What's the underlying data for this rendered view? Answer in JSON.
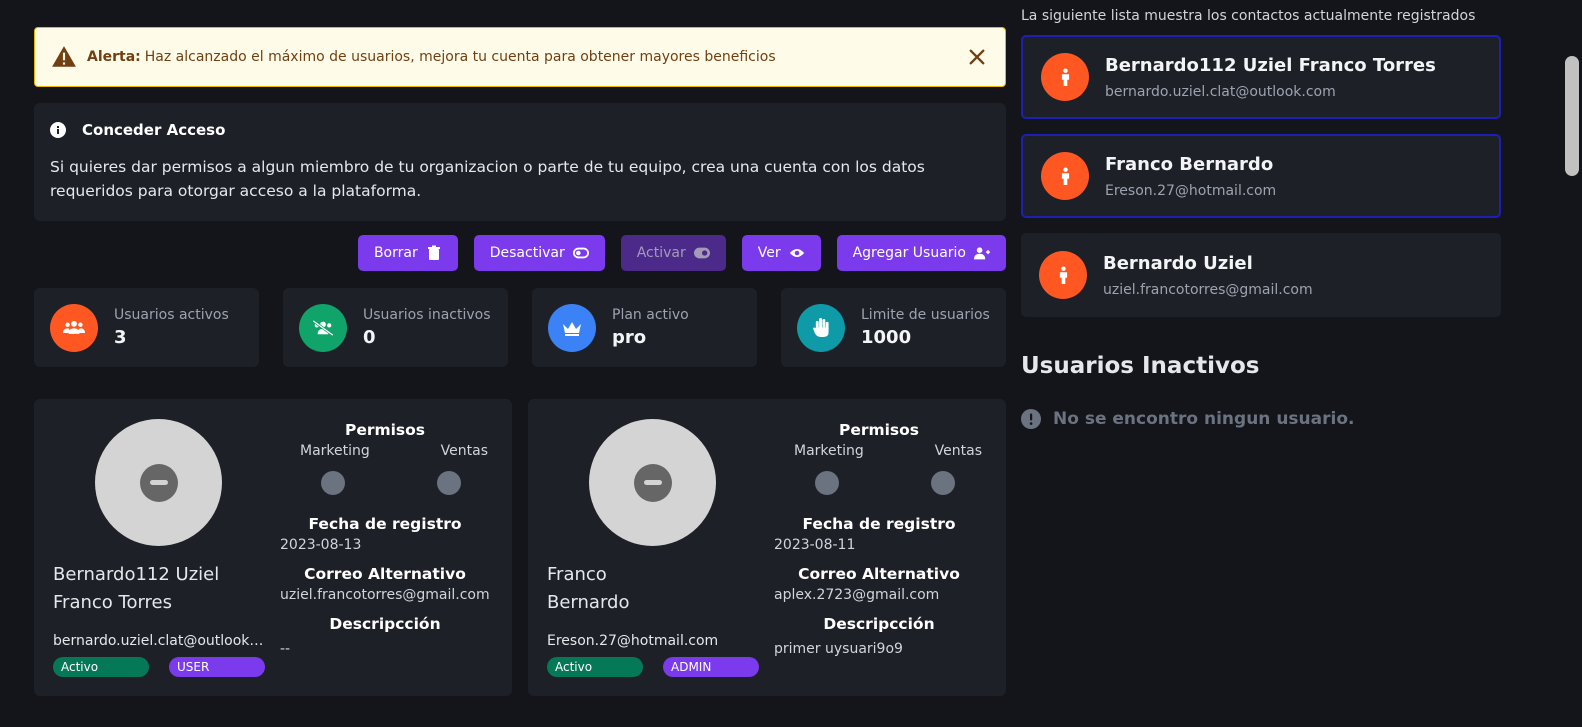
{
  "alert": {
    "label": "Alerta:",
    "message": "Haz alcanzado el máximo de usuarios, mejora tu cuenta para obtener mayores beneficios"
  },
  "info": {
    "title": "Conceder Acceso",
    "body": "Si quieres dar permisos a algun miembro de tu organizacion o parte de tu equipo, crea una cuenta con los datos requeridos para otorgar acceso a la plataforma."
  },
  "actions": {
    "delete": "Borrar",
    "deactivate": "Desactivar",
    "activate": "Activar",
    "view": "Ver",
    "add_user": "Agregar Usuario"
  },
  "stats": [
    {
      "label": "Usuarios activos",
      "value": "3",
      "color": "#ff5722",
      "icon": "users-icon"
    },
    {
      "label": "Usuarios inactivos",
      "value": "0",
      "color": "#10a36a",
      "icon": "users-slash-icon"
    },
    {
      "label": "Plan activo",
      "value": "pro",
      "color": "#3b82f6",
      "icon": "crown-icon"
    },
    {
      "label": "Limite de usuarios",
      "value": "1000",
      "color": "#0e9aa7",
      "icon": "hand-icon"
    }
  ],
  "cards": [
    {
      "name": "Bernardo112 Uziel Franco Torres",
      "email": "bernardo.uziel.clat@outlook.c...",
      "status": "Activo",
      "role": "USER",
      "permissions_title": "Permisos",
      "perm_a": "Marketing",
      "perm_b": "Ventas",
      "date_title": "Fecha de registro",
      "date": "2023-08-13",
      "alt_title": "Correo Alternativo",
      "alt": "uziel.francotorres@gmail.com",
      "desc_title": "Descripcción",
      "desc": "--"
    },
    {
      "name": "Franco Bernardo",
      "email": "Ereson.27@hotmail.com",
      "status": "Activo",
      "role": "ADMIN",
      "permissions_title": "Permisos",
      "perm_a": "Marketing",
      "perm_b": "Ventas",
      "date_title": "Fecha de registro",
      "date": "2023-08-11",
      "alt_title": "Correo Alternativo",
      "alt": "aplex.2723@gmail.com",
      "desc_title": "Descripcción",
      "desc": "primer uysuari9o9"
    }
  ],
  "contacts": {
    "intro": "La siguiente lista muestra los contactos actualmente registrados",
    "items": [
      {
        "name": "Bernardo112 Uziel Franco Torres",
        "email": "bernardo.uziel.clat@outlook.com"
      },
      {
        "name": "Franco Bernardo",
        "email": "Ereson.27@hotmail.com"
      },
      {
        "name": "Bernardo Uziel",
        "email": "uziel.francotorres@gmail.com"
      }
    ]
  },
  "inactive": {
    "title": "Usuarios Inactivos",
    "empty": "No se encontro ningun usuario."
  }
}
